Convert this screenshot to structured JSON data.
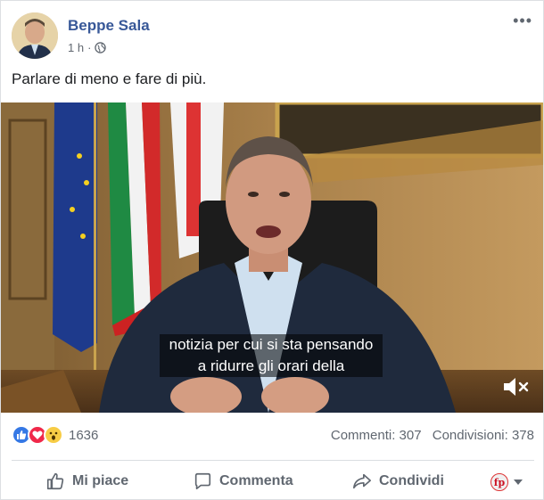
{
  "post": {
    "author": "Beppe Sala",
    "time": "1 h",
    "separator": "·",
    "more_label": "•••",
    "text": "Parlare di meno e fare di più."
  },
  "video": {
    "subtitle_line1": "notizia per cui si sta pensando",
    "subtitle_line2": "a ridurre gli orari della"
  },
  "stats": {
    "reactions": [
      "like-icon",
      "love-icon",
      "wow-icon"
    ],
    "reaction_count": "1636",
    "comments": "Commenti: 307",
    "shares": "Condivisioni: 378"
  },
  "actions": {
    "like": "Mi piace",
    "comment": "Commenta",
    "share": "Condividi",
    "extra_badge": "fp"
  },
  "colors": {
    "author": "#385898",
    "like": "#3578e5",
    "love": "#f0284a",
    "wow": "#f7cc45"
  }
}
